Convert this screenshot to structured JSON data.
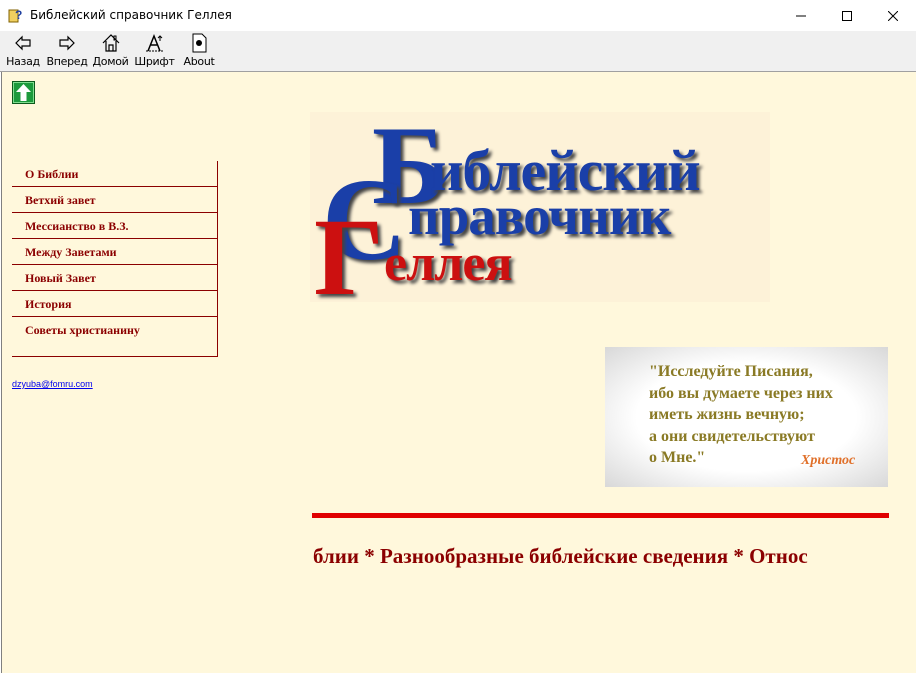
{
  "window": {
    "title": "Библейский справочник Геллея",
    "buttons": {
      "minimize": "minimize",
      "maximize": "maximize",
      "close": "close"
    }
  },
  "toolbar": {
    "back": "Назад",
    "forward": "Вперед",
    "home": "Домой",
    "font": "Шрифт",
    "about": "About"
  },
  "content": {
    "up_icon": "up-arrow-icon",
    "menu": [
      "О Библии",
      "Ветхий завет",
      "Мессианство в В.З.",
      "Между Заветами",
      "Новый Завет",
      "История",
      "Советы христианину"
    ],
    "email": "dzyuba@fomru.com",
    "logo": {
      "letter1": "Б",
      "word1": "иблейский",
      "letter2": "С",
      "word2": "правочник",
      "letter3": "Г",
      "word3": "еллея",
      "colors": {
        "blue": "#1a3fa8",
        "red": "#cc1010"
      }
    },
    "quote": {
      "text": "\"Исследуйте Писания,\nибо вы думаете через них\nиметь жизнь вечную;\nа они свидетельствуют\nо Мне.\"",
      "author": "Христос"
    },
    "marquee": "блии * Разнообразные библейские сведения * Относ"
  },
  "colors": {
    "background": "#fff8dc",
    "menu_text": "#8b0000",
    "quote_text": "#8a7a25",
    "quote_author": "#e0702a",
    "divider": "#e00000"
  }
}
